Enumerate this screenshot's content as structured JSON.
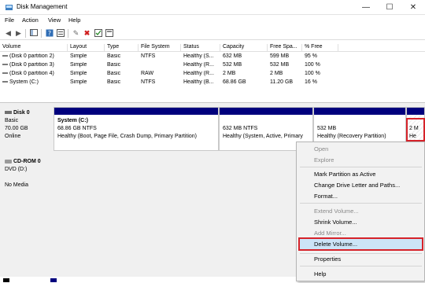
{
  "window": {
    "title": "Disk Management",
    "controls": [
      "—",
      "☐",
      "✕"
    ]
  },
  "menu": [
    "File",
    "Action",
    "View",
    "Help"
  ],
  "toolbar": {
    "icons": [
      "back-icon",
      "forward-icon",
      "console-tree-icon",
      "help-icon",
      "properties-icon",
      "connect-icon",
      "delete-icon",
      "check-icon",
      "settings-icon"
    ]
  },
  "volume_table": {
    "headers": [
      "Volume",
      "Layout",
      "Type",
      "File System",
      "Status",
      "Capacity",
      "Free Spa...",
      "% Free"
    ],
    "rows": [
      [
        "(Disk 0 partition 2)",
        "Simple",
        "Basic",
        "NTFS",
        "Healthy (S...",
        "632 MB",
        "599 MB",
        "95 %"
      ],
      [
        "(Disk 0 partition 3)",
        "Simple",
        "Basic",
        "",
        "Healthy (R...",
        "532 MB",
        "532 MB",
        "100 %"
      ],
      [
        "(Disk 0 partition 4)",
        "Simple",
        "Basic",
        "RAW",
        "Healthy (R...",
        "2 MB",
        "2 MB",
        "100 %"
      ],
      [
        "System (C:)",
        "Simple",
        "Basic",
        "NTFS",
        "Healthy (B...",
        "68.86 GB",
        "11.20 GB",
        "16 %"
      ]
    ]
  },
  "disks": [
    {
      "name": "Disk 0",
      "type": "Basic",
      "size": "70.00 GB",
      "status": "Online"
    },
    {
      "name": "CD-ROM 0",
      "type": "DVD (D:)",
      "size": "",
      "status": "No Media"
    }
  ],
  "partitions": [
    {
      "title": "System  (C:)",
      "line1": "68.86 GB NTFS",
      "line2": "Healthy (Boot, Page File, Crash Dump, Primary Partition)"
    },
    {
      "title": "",
      "line1": "632 MB NTFS",
      "line2": "Healthy (System, Active, Primary"
    },
    {
      "title": "",
      "line1": "532 MB",
      "line2": "Healthy (Recovery Partition)"
    },
    {
      "title": "",
      "line1": "2 M",
      "line2": "He"
    }
  ],
  "context_menu": [
    {
      "label": "Open",
      "enabled": false
    },
    {
      "label": "Explore",
      "enabled": false
    },
    {
      "label": "Mark Partition as Active",
      "enabled": true
    },
    {
      "label": "Change Drive Letter and Paths...",
      "enabled": true
    },
    {
      "label": "Format...",
      "enabled": true
    },
    {
      "label": "Extend Volume...",
      "enabled": false
    },
    {
      "label": "Shrink Volume...",
      "enabled": true
    },
    {
      "label": "Add Mirror...",
      "enabled": false
    },
    {
      "label": "Delete Volume...",
      "enabled": true,
      "highlighted": true
    },
    {
      "label": "Properties",
      "enabled": true
    },
    {
      "label": "Help",
      "enabled": true
    }
  ],
  "colors": {
    "partition_bar": "#00007d",
    "highlight": "#cce4f7",
    "annotation_red": "#d6232a"
  }
}
